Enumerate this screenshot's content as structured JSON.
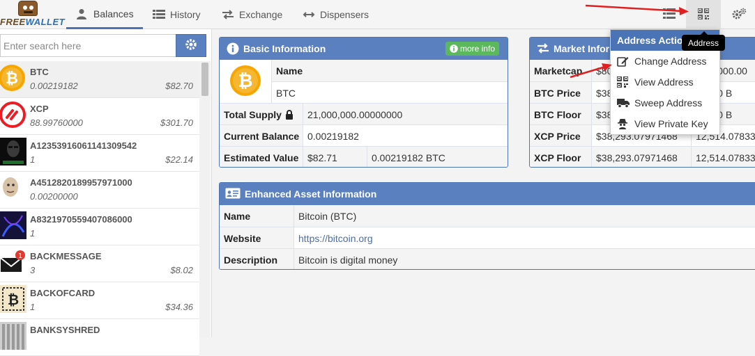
{
  "brand": {
    "logo_text_a": "FREE",
    "logo_text_b": "WALLET"
  },
  "nav": {
    "tabs": [
      {
        "label": "Balances",
        "icon": "user-icon"
      },
      {
        "label": "History",
        "icon": "list-icon"
      },
      {
        "label": "Exchange",
        "icon": "exchange-icon"
      },
      {
        "label": "Dispensers",
        "icon": "arrows-horizontal-icon"
      }
    ],
    "active_tab": "Balances"
  },
  "search": {
    "placeholder": "Enter search here"
  },
  "assets": [
    {
      "name": "BTC",
      "qty": "0.00219182",
      "value": "$82.70",
      "icon": "bitcoin-icon"
    },
    {
      "name": "XCP",
      "qty": "88.99760000",
      "value": "$301.70",
      "icon": "counterparty-icon"
    },
    {
      "name": "A12353916061141309542",
      "qty": "1",
      "value": "$22.14",
      "icon": "matrix-art-icon"
    },
    {
      "name": "A4512820189957971000",
      "qty": "0.00200000",
      "value": "",
      "icon": "meme-face-icon"
    },
    {
      "name": "A8321970559407086000",
      "qty": "1",
      "value": "",
      "icon": "dark-art-icon"
    },
    {
      "name": "BACKMESSAGE",
      "qty": "3",
      "value": "$8.02",
      "icon": "envelope-notification-icon"
    },
    {
      "name": "BACKOFCARD",
      "qty": "1",
      "value": "$34.36",
      "icon": "bitcoin-card-icon"
    },
    {
      "name": "BANKSYSHRED",
      "qty": "",
      "value": "",
      "icon": "shred-art-icon"
    }
  ],
  "basic_info": {
    "title": "Basic Information",
    "more_info_label": "more info",
    "name_label": "Name",
    "name_value": "BTC",
    "total_supply_label": "Total Supply",
    "total_supply_value": "21,000,000.00000000",
    "current_balance_label": "Current Balance",
    "current_balance_value": "0.00219182",
    "estimated_value_label": "Estimated Value",
    "estimated_value_usd": "$82.71",
    "estimated_value_btc": "0.00219182 BTC"
  },
  "market_info": {
    "title": "Market Infor",
    "rows": [
      {
        "label": "Marketcap",
        "v1": "$80",
        "v2": ",000,000.00"
      },
      {
        "label": "BTC Price",
        "v1": "$38",
        "v2": "00000 B"
      },
      {
        "label": "BTC Floor",
        "v1": "$38",
        "v2": "00000 B"
      },
      {
        "label": "XCP Price",
        "v1": "$38,293.07971468",
        "v2": "12,514.07833"
      },
      {
        "label": "XCP Floor",
        "v1": "$38,293.07971468",
        "v2": "12,514.07833"
      }
    ]
  },
  "enhanced_info": {
    "title": "Enhanced Asset Information",
    "rows": [
      {
        "label": "Name",
        "value": "Bitcoin (BTC)",
        "is_link": false
      },
      {
        "label": "Website",
        "value": "https://bitcoin.org",
        "is_link": true
      },
      {
        "label": "Description",
        "value": "Bitcoin is digital money",
        "is_link": false
      }
    ]
  },
  "address_menu": {
    "title": "Address Actio",
    "items": [
      {
        "label": "Change Address",
        "icon": "edit-icon"
      },
      {
        "label": "View Address",
        "icon": "qrcode-icon"
      },
      {
        "label": "Sweep Address",
        "icon": "truck-icon"
      },
      {
        "label": "View Private Key",
        "icon": "spy-icon"
      }
    ]
  },
  "tooltip": {
    "text": "Address"
  },
  "colors": {
    "header_blue": "#5b80bf",
    "accent_green": "#5cb85c",
    "link": "#4a6ea9",
    "arrow_red": "#e02020"
  }
}
